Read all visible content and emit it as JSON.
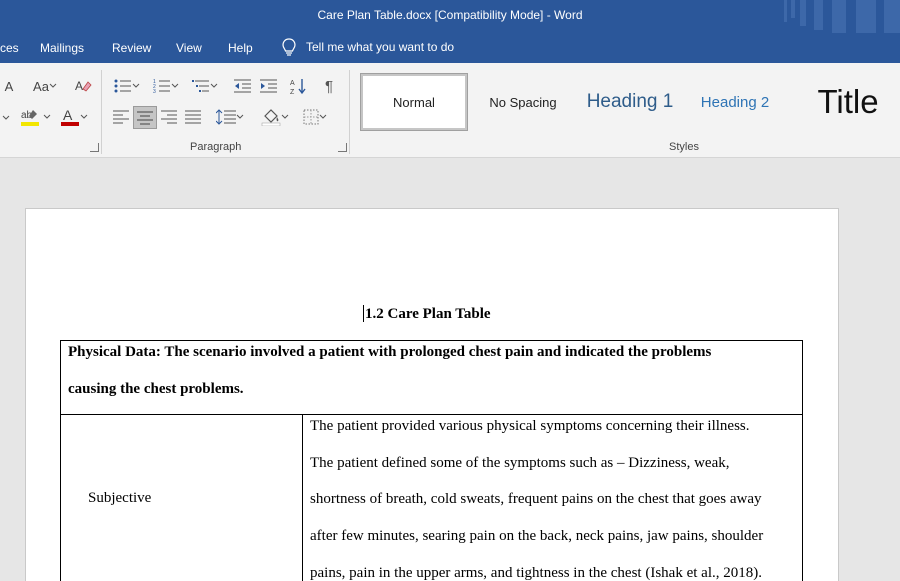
{
  "window": {
    "title": "Care Plan Table.docx [Compatibility Mode]  -  Word"
  },
  "menu": {
    "items": [
      "ces",
      "Mailings",
      "Review",
      "View",
      "Help"
    ],
    "tell_me": "Tell me what you want to do"
  },
  "ribbon": {
    "font_group": {
      "font_case_label": "Aa",
      "font_size_grow_label": "A"
    },
    "paragraph_group_label": "Paragraph",
    "styles_group_label": "Styles",
    "styles": [
      "Normal",
      "No Spacing",
      "Heading 1",
      "Heading 2",
      "Title"
    ],
    "selected_style": "Normal",
    "selected_alignment": "center",
    "colors": {
      "highlight": "#f2e600",
      "font_color": "#c00000"
    }
  },
  "document": {
    "heading": "1.2 Care Plan Table",
    "table": {
      "physical_data_lines": [
        "Physical Data: The scenario involved a patient with prolonged chest pain and indicated the problems",
        "causing the chest problems."
      ],
      "row_label": "Subjective",
      "row_text_lines": [
        "The patient provided various physical symptoms concerning their illness.",
        "The patient defined some of the symptoms such as – Dizziness, weak,",
        "shortness of breath, cold sweats, frequent pains on the chest that goes away",
        "after few minutes, searing pain on the back, neck pains, jaw pains, shoulder",
        "pains, pain in the upper arms, and tightness in the chest (Ishak et al., 2018)."
      ]
    }
  },
  "colors": {
    "accent": "#2b579a",
    "ribbon_bg": "#f3f3f3",
    "canvas_bg": "#e6e6e6"
  }
}
